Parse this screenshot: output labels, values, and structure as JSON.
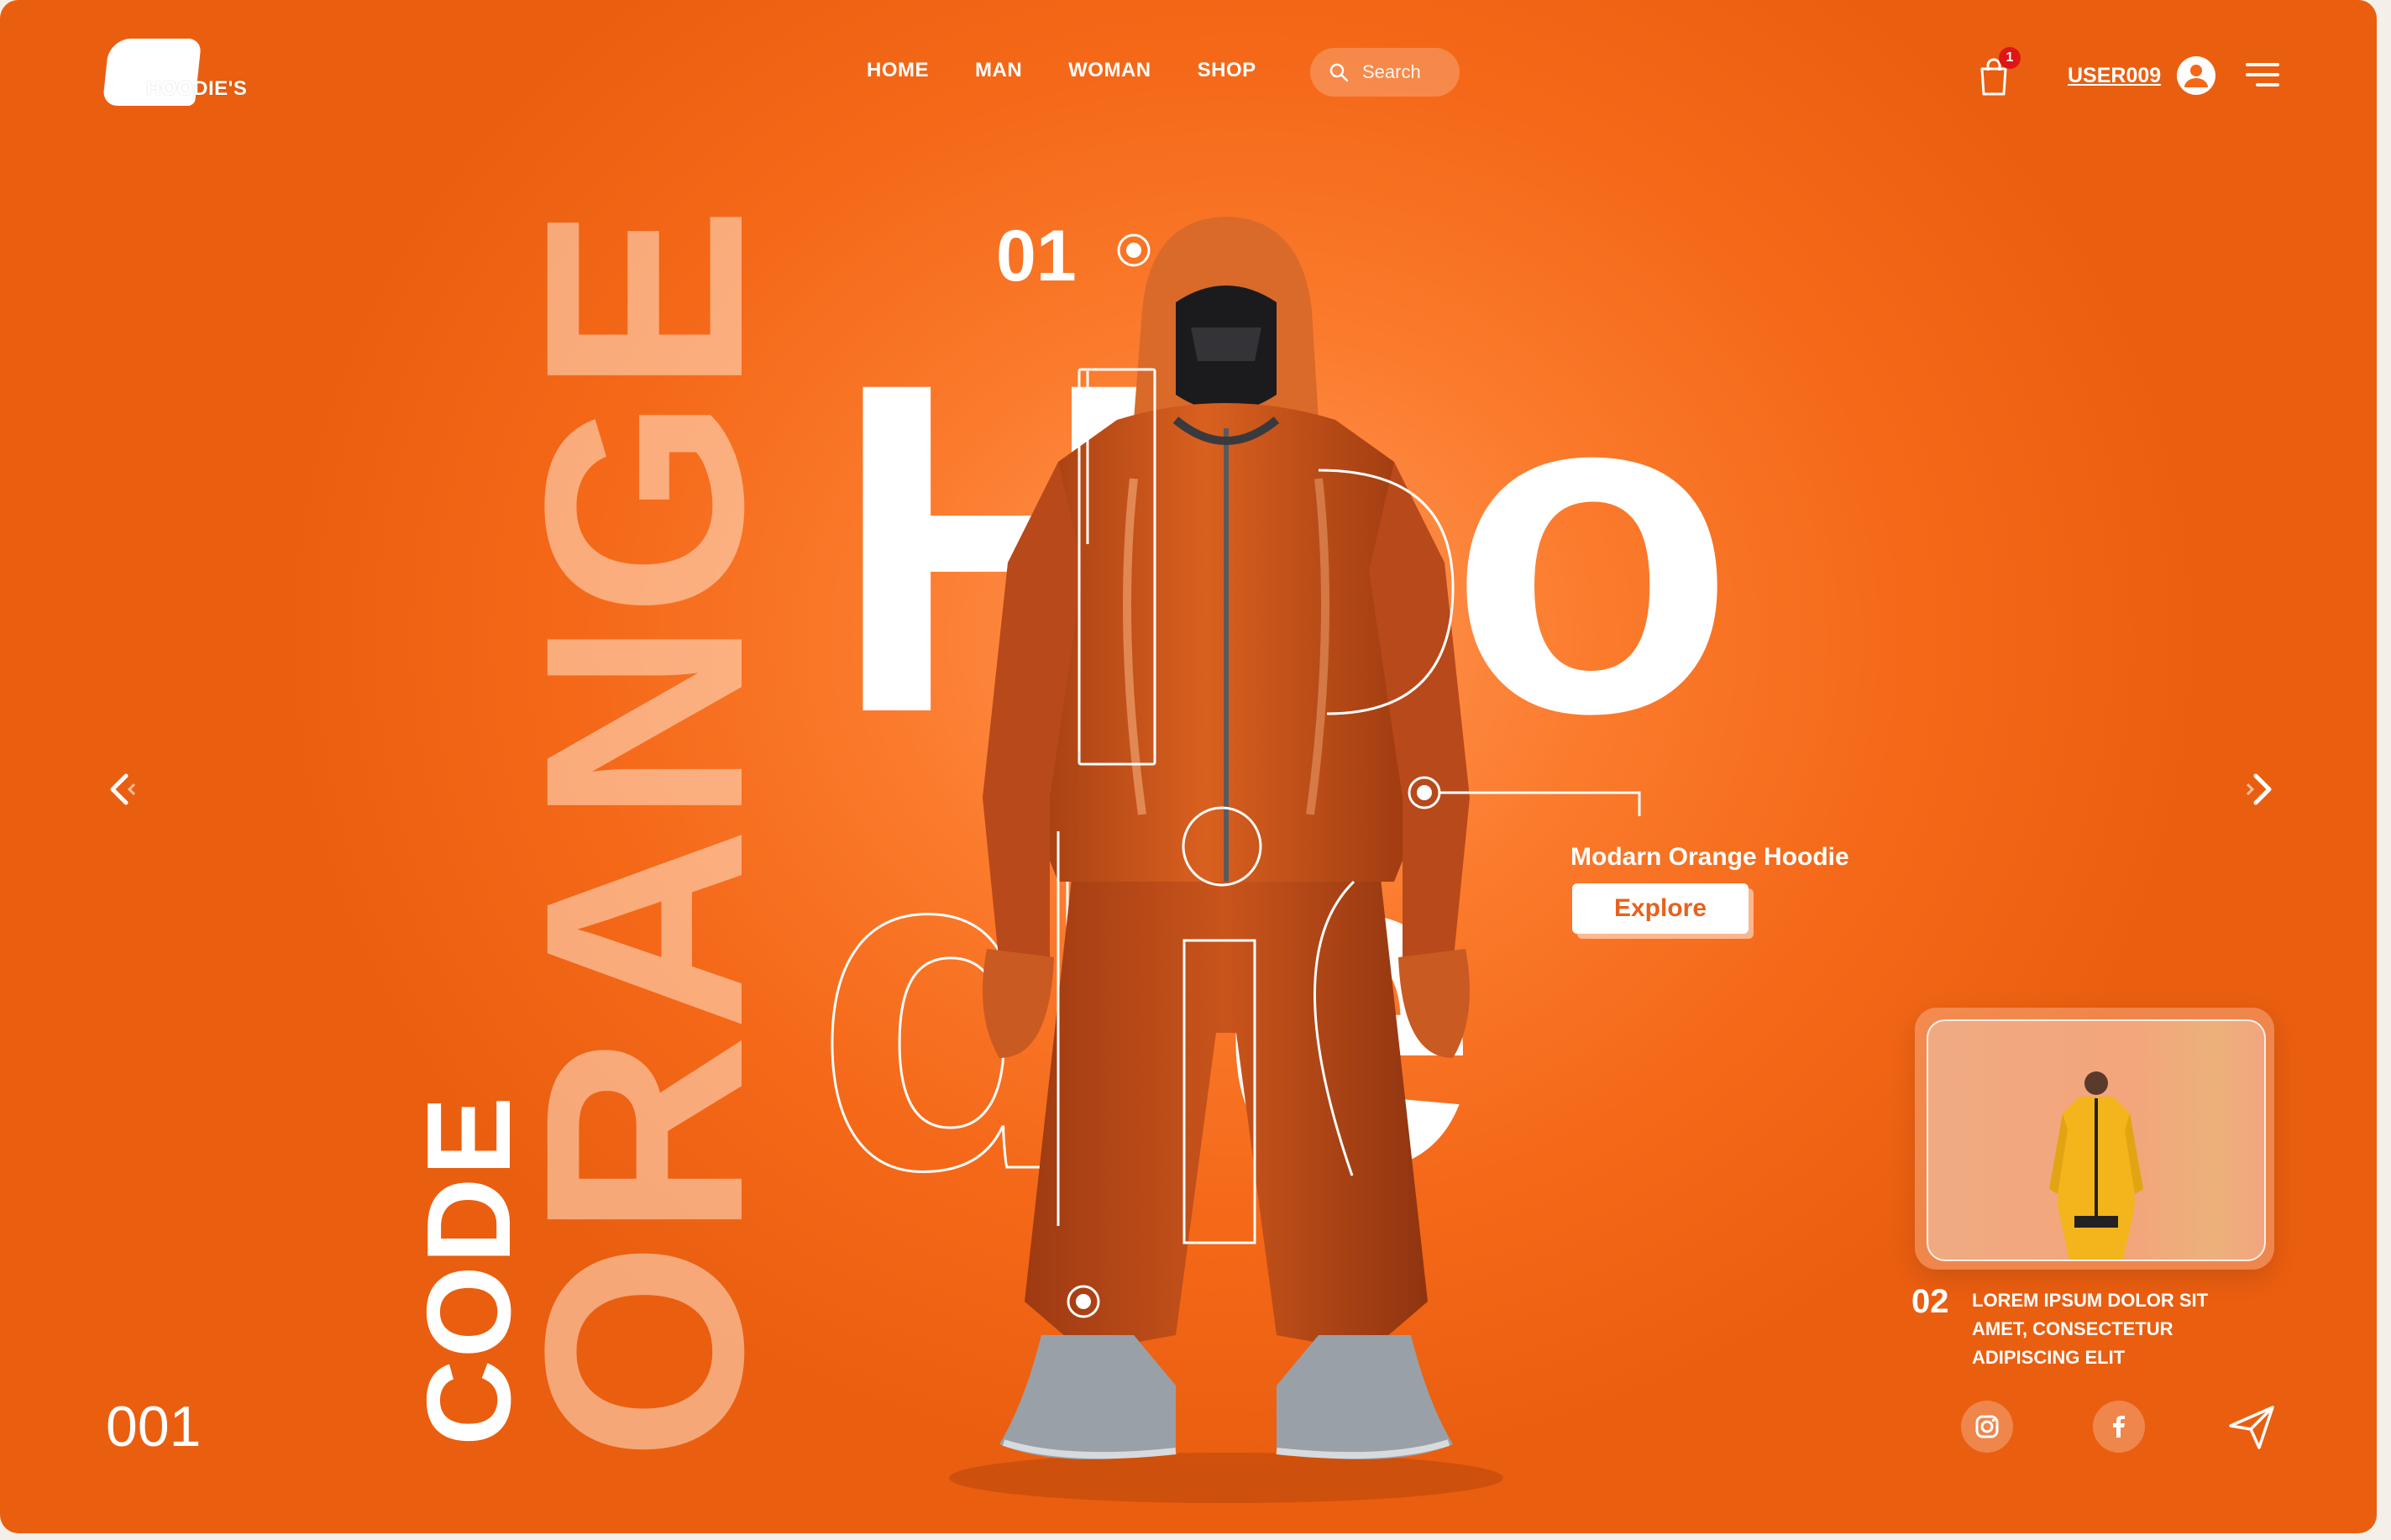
{
  "brand": {
    "logo_text": "HOODIE'S"
  },
  "nav": {
    "items": [
      "HOME",
      "MAN",
      "WOMAN",
      "SHOP"
    ]
  },
  "search": {
    "placeholder": "Search"
  },
  "cart": {
    "badge_count": "1"
  },
  "user": {
    "name": "USER009"
  },
  "hero": {
    "slide_number": "01",
    "title_line1": "Hoo",
    "title_line2_a": "d",
    "title_line2_b": "ie",
    "vertical_word": "ORANGE",
    "vertical_prefix": "CODE",
    "page_counter": "001"
  },
  "product": {
    "name": "Modarn Orange Hoodie",
    "cta": "Explore"
  },
  "next_card": {
    "number": "02",
    "description": "LOREM IPSUM DOLOR SIT AMET, CONSECTETUR ADIPISCING ELIT"
  },
  "colors": {
    "background": "#f46818",
    "accent_white": "#ffffff",
    "badge": "#e01515"
  },
  "icons": [
    "cart-icon",
    "user-avatar-icon",
    "menu-icon",
    "search-icon",
    "chevron-left-icon",
    "chevron-right-icon",
    "instagram-icon",
    "facebook-icon",
    "send-icon"
  ]
}
